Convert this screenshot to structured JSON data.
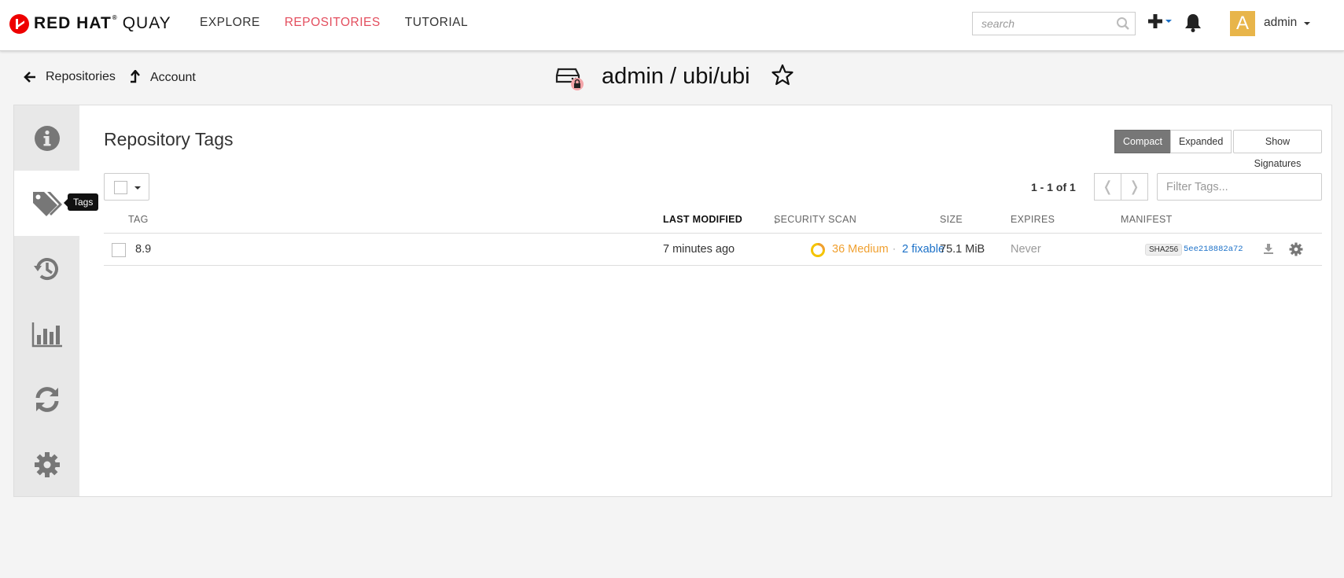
{
  "brand": {
    "name": "RED HAT",
    "reg": "®",
    "product": "QUAY"
  },
  "nav": {
    "links": [
      "EXPLORE",
      "REPOSITORIES",
      "TUTORIAL"
    ],
    "active": "REPOSITORIES"
  },
  "search": {
    "placeholder": "search"
  },
  "user": {
    "avatar_letter": "A",
    "name": "admin",
    "avatar_color": "#e8b54a"
  },
  "breadcrumbs": {
    "repositories": "Repositories",
    "account": "Account"
  },
  "repo": {
    "title": "admin / ubi/ubi"
  },
  "sidebar": {
    "items": [
      "info-icon",
      "tags-icon",
      "history-icon",
      "usage-chart-icon",
      "mirroring-icon",
      "settings-icon"
    ],
    "active_tooltip": "Tags"
  },
  "tags_view": {
    "title": "Repository Tags",
    "view_buttons": {
      "compact": "Compact",
      "expanded": "Expanded",
      "signatures": "Show Signatures"
    },
    "pagination": {
      "text": "1 - 1 of 1",
      "prev": "❬",
      "next": "❭"
    },
    "filter": {
      "placeholder": "Filter Tags..."
    },
    "columns": {
      "tag": "TAG",
      "last_modified": "LAST MODIFIED",
      "security_scan": "SECURITY SCAN",
      "size": "SIZE",
      "expires": "EXPIRES",
      "manifest": "MANIFEST"
    },
    "sort_arrow": "↓",
    "rows": [
      {
        "tag": "8.9",
        "last_modified": "7 minutes ago",
        "scan_medium": "36 Medium",
        "scan_sep": "·",
        "scan_fixable": "2 fixable",
        "size": "75.1 MiB",
        "expires": "Never",
        "manifest_algo": "SHA256",
        "manifest_digest": "5ee218882a72"
      }
    ]
  },
  "colors": {
    "accent": "#e34e5e",
    "warning": "#f0a030",
    "link": "#1c71c8",
    "brand_red": "#ee0000"
  }
}
